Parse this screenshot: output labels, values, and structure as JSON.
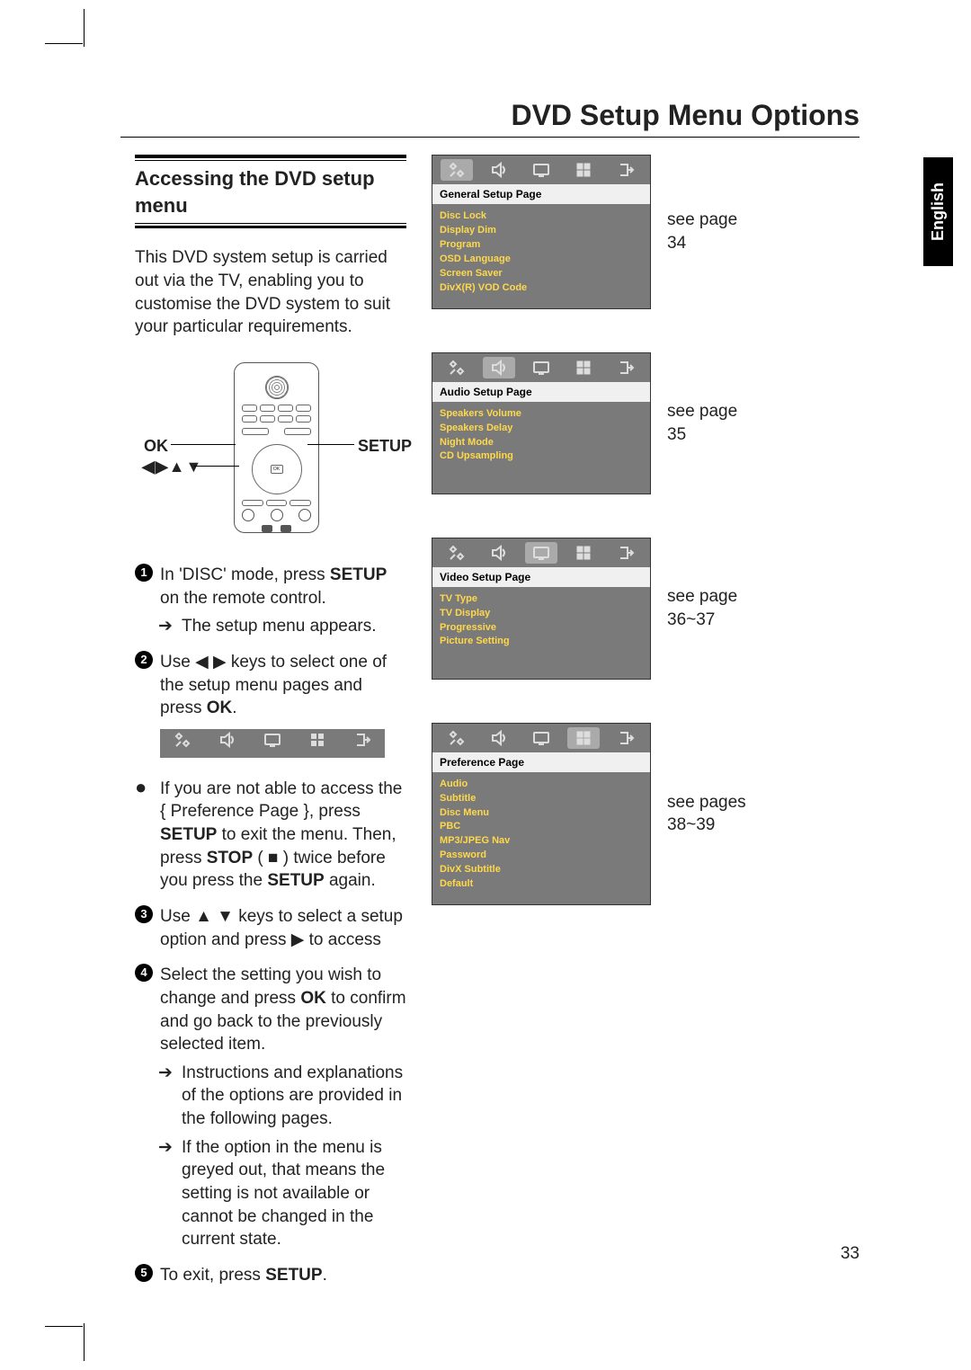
{
  "title": "DVD Setup Menu Options",
  "lang_tab": "English",
  "page_number": "33",
  "section_head": "Accessing the DVD setup menu",
  "intro": "This DVD system setup is carried out via the TV, enabling you to customise the DVD system to suit your particular requirements.",
  "remote": {
    "label_ok": "OK",
    "label_setup": "SETUP",
    "label_arrows": "◀▶▲▼"
  },
  "steps": {
    "s1_pre": "In 'DISC' mode, press ",
    "s1_bold": "SETUP",
    "s1_post": " on the remote control.",
    "s1_sub": "The setup menu appears.",
    "s2_pre": "Use ◀ ▶ keys to select one of the setup menu pages and press ",
    "s2_bold": "OK",
    "s2_post": ".",
    "note_pre": "If you are not able to access the { Preference Page }, press ",
    "note_b1": "SETUP",
    "note_mid": " to exit the menu.  Then, press ",
    "note_b2": "STOP",
    "note_mid2": " ( ■ ) twice before you press the ",
    "note_b3": "SETUP",
    "note_post": " again.",
    "s3": "Use ▲ ▼ keys to select a setup option and press ▶ to access",
    "s4_pre": "Select the setting you wish to change and press ",
    "s4_bold": "OK",
    "s4_post": " to confirm and go back to the previously selected item.",
    "s4_sub1": "Instructions and explanations of the options are provided in the following pages.",
    "s4_sub2": "If the option in the menu is greyed out, that means the setting is not available or cannot be changed in the current state.",
    "s5_pre": "To exit, press ",
    "s5_bold": "SETUP",
    "s5_post": "."
  },
  "panels": [
    {
      "title": "General Setup Page",
      "items": [
        "Disc Lock",
        "Display Dim",
        "Program",
        "OSD Language",
        "Screen Saver",
        "DivX(R) VOD Code"
      ],
      "ref": "see page 34",
      "selected_icon": 0
    },
    {
      "title": "Audio Setup Page",
      "items": [
        "Speakers Volume",
        "Speakers Delay",
        "Night Mode",
        "CD Upsampling"
      ],
      "ref": "see page 35",
      "selected_icon": 1
    },
    {
      "title": "Video Setup Page",
      "items": [
        "TV Type",
        "TV Display",
        "Progressive",
        "Picture Setting"
      ],
      "ref": "see page 36~37",
      "selected_icon": 2
    },
    {
      "title": "Preference Page",
      "items": [
        "Audio",
        "Subtitle",
        "Disc Menu",
        "PBC",
        "MP3/JPEG Nav",
        "Password",
        "DivX Subtitle",
        "Default"
      ],
      "ref": "see pages 38~39",
      "selected_icon": 3
    }
  ]
}
